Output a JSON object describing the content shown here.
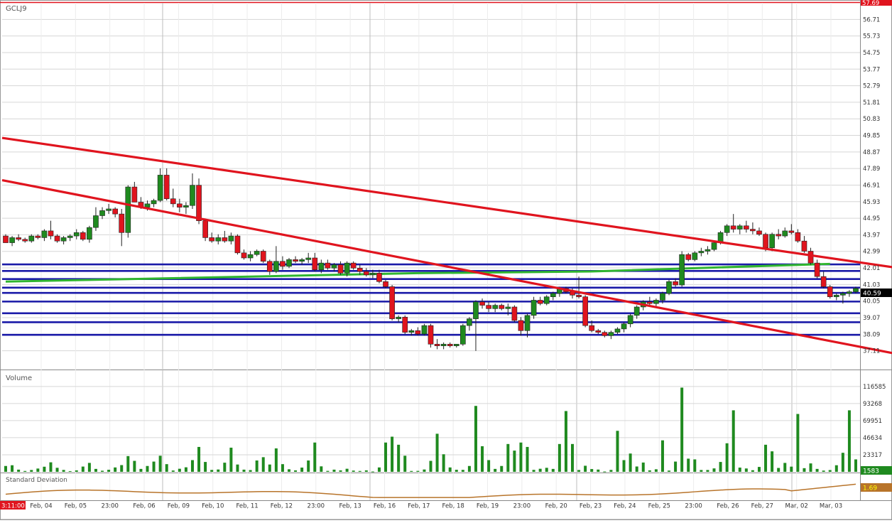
{
  "symbol": "GCLJ9",
  "top_price_label": "57.69",
  "volume_panel_label": "Volume",
  "stddev_panel_label": "Standard Deviation",
  "current_time_label": "3:11:00",
  "colors": {
    "up": "#1f8a1f",
    "down": "#e0141e",
    "trendline": "#e0141e",
    "support": "#1a1aa8",
    "moving_average": "#2fb52f",
    "stddev_line": "#b8742a",
    "grid": "#d6d6d6",
    "axis_highlight": "#ffff00"
  },
  "chart_data": {
    "type": "candlestick",
    "price_axis": {
      "ticks": [
        "56.71",
        "55.73",
        "54.75",
        "53.77",
        "52.79",
        "51.81",
        "50.83",
        "49.85",
        "48.87",
        "47.89",
        "46.91",
        "45.93",
        "44.95",
        "43.97",
        "42.99",
        "42.01",
        "41.03",
        "40.05",
        "39.07",
        "38.09",
        "37.11"
      ],
      "ylim": [
        36.0,
        57.69
      ],
      "last_price": "40.59"
    },
    "x_labels": [
      "Feb, 04",
      "Feb, 05",
      "23:00",
      "Feb, 06",
      "Feb, 09",
      "Feb, 10",
      "Feb, 11",
      "Feb, 12",
      "23:00",
      "Feb, 13",
      "Feb, 16",
      "Feb, 17",
      "Feb, 18",
      "Feb, 19",
      "23:00",
      "Feb, 20",
      "Feb, 23",
      "Feb, 24",
      "Feb, 25",
      "23:00",
      "Feb, 26",
      "Feb, 27",
      "Mar, 02",
      "Mar, 03"
    ],
    "candles": [
      [
        43.9,
        44.0,
        43.5,
        43.5
      ],
      [
        43.5,
        43.9,
        43.3,
        43.8
      ],
      [
        43.8,
        44.0,
        43.6,
        43.7
      ],
      [
        43.7,
        43.8,
        43.5,
        43.6
      ],
      [
        43.6,
        44.0,
        43.5,
        43.9
      ],
      [
        43.9,
        44.0,
        43.7,
        43.8
      ],
      [
        43.8,
        44.3,
        43.6,
        44.2
      ],
      [
        44.2,
        44.8,
        43.7,
        43.9
      ],
      [
        43.9,
        44.0,
        43.5,
        43.6
      ],
      [
        43.6,
        43.9,
        43.4,
        43.8
      ],
      [
        43.8,
        44.0,
        43.6,
        43.9
      ],
      [
        43.9,
        44.3,
        43.7,
        44.1
      ],
      [
        44.1,
        44.2,
        43.6,
        43.7
      ],
      [
        43.7,
        44.5,
        43.5,
        44.4
      ],
      [
        44.4,
        45.6,
        44.2,
        45.1
      ],
      [
        45.1,
        45.6,
        44.9,
        45.4
      ],
      [
        45.4,
        45.8,
        45.2,
        45.5
      ],
      [
        45.5,
        45.6,
        45.0,
        45.2
      ],
      [
        45.2,
        45.5,
        43.3,
        44.1
      ],
      [
        44.1,
        46.9,
        43.8,
        46.8
      ],
      [
        46.8,
        47.1,
        45.9,
        45.9
      ],
      [
        45.9,
        46.2,
        45.5,
        45.6
      ],
      [
        45.6,
        46.0,
        45.4,
        45.8
      ],
      [
        45.8,
        46.1,
        45.6,
        46.0
      ],
      [
        46.0,
        47.9,
        45.9,
        47.5
      ],
      [
        47.5,
        47.9,
        46.0,
        46.1
      ],
      [
        46.1,
        46.7,
        45.6,
        45.8
      ],
      [
        45.8,
        46.1,
        45.3,
        45.6
      ],
      [
        45.6,
        45.9,
        45.2,
        45.7
      ],
      [
        45.7,
        47.6,
        45.5,
        46.9
      ],
      [
        46.9,
        47.3,
        44.6,
        44.8
      ],
      [
        44.8,
        44.9,
        43.6,
        43.8
      ],
      [
        43.8,
        44.1,
        43.5,
        43.6
      ],
      [
        43.6,
        44.0,
        43.4,
        43.8
      ],
      [
        43.8,
        44.2,
        43.5,
        43.6
      ],
      [
        43.6,
        44.1,
        43.4,
        43.9
      ],
      [
        43.9,
        44.0,
        42.8,
        42.9
      ],
      [
        42.9,
        43.1,
        42.5,
        42.6
      ],
      [
        42.6,
        43.0,
        42.4,
        42.8
      ],
      [
        42.8,
        43.1,
        42.7,
        43.0
      ],
      [
        43.0,
        43.1,
        42.3,
        42.4
      ],
      [
        42.4,
        42.5,
        41.6,
        41.8
      ],
      [
        41.8,
        43.3,
        41.7,
        42.4
      ],
      [
        42.4,
        42.7,
        41.9,
        42.1
      ],
      [
        42.1,
        42.6,
        42.0,
        42.5
      ],
      [
        42.5,
        42.7,
        42.3,
        42.4
      ],
      [
        42.4,
        42.6,
        42.2,
        42.5
      ],
      [
        42.5,
        42.9,
        42.3,
        42.6
      ],
      [
        42.6,
        42.9,
        41.8,
        41.9
      ],
      [
        41.9,
        42.5,
        41.7,
        42.3
      ],
      [
        42.3,
        42.5,
        41.9,
        42.0
      ],
      [
        42.0,
        42.3,
        41.8,
        42.2
      ],
      [
        42.2,
        42.4,
        41.6,
        41.7
      ],
      [
        41.7,
        42.4,
        41.5,
        42.3
      ],
      [
        42.3,
        42.4,
        41.9,
        42.0
      ],
      [
        42.0,
        42.2,
        41.6,
        41.8
      ],
      [
        41.8,
        42.0,
        41.5,
        41.6
      ],
      [
        41.6,
        41.9,
        41.4,
        41.7
      ],
      [
        41.7,
        41.9,
        41.1,
        41.2
      ],
      [
        41.2,
        41.3,
        40.8,
        40.9
      ],
      [
        40.9,
        41.0,
        38.9,
        39.0
      ],
      [
        39.0,
        39.2,
        38.8,
        39.1
      ],
      [
        39.1,
        39.2,
        38.1,
        38.2
      ],
      [
        38.2,
        38.4,
        38.0,
        38.3
      ],
      [
        38.3,
        38.5,
        38.0,
        38.1
      ],
      [
        38.1,
        38.7,
        38.0,
        38.6
      ],
      [
        38.6,
        38.7,
        37.3,
        37.5
      ],
      [
        37.5,
        37.8,
        37.2,
        37.4
      ],
      [
        37.4,
        37.6,
        37.2,
        37.5
      ],
      [
        37.5,
        37.6,
        37.3,
        37.4
      ],
      [
        37.4,
        37.5,
        37.3,
        37.5
      ],
      [
        37.5,
        38.7,
        37.4,
        38.6
      ],
      [
        38.6,
        39.1,
        38.3,
        39.0
      ],
      [
        39.0,
        40.1,
        37.1,
        40.0
      ],
      [
        40.0,
        40.2,
        39.6,
        39.8
      ],
      [
        39.8,
        40.0,
        39.4,
        39.6
      ],
      [
        39.6,
        39.9,
        39.4,
        39.8
      ],
      [
        39.8,
        39.9,
        39.5,
        39.6
      ],
      [
        39.6,
        39.9,
        39.2,
        39.7
      ],
      [
        39.7,
        39.8,
        38.8,
        38.9
      ],
      [
        38.9,
        39.1,
        38.0,
        38.3
      ],
      [
        38.3,
        39.3,
        37.9,
        39.2
      ],
      [
        39.2,
        40.3,
        39.0,
        40.1
      ],
      [
        40.1,
        40.3,
        39.8,
        39.9
      ],
      [
        39.9,
        40.4,
        39.8,
        40.3
      ],
      [
        40.3,
        40.6,
        40.1,
        40.5
      ],
      [
        40.5,
        40.9,
        40.3,
        40.8
      ],
      [
        40.8,
        40.9,
        40.5,
        40.6
      ],
      [
        40.6,
        40.8,
        40.2,
        40.4
      ],
      [
        40.4,
        41.5,
        40.2,
        40.3
      ],
      [
        40.3,
        40.4,
        38.5,
        38.6
      ],
      [
        38.6,
        38.9,
        38.2,
        38.3
      ],
      [
        38.3,
        38.4,
        38.1,
        38.2
      ],
      [
        38.2,
        38.3,
        37.9,
        38.0
      ],
      [
        38.0,
        38.3,
        37.8,
        38.2
      ],
      [
        38.2,
        38.5,
        38.1,
        38.4
      ],
      [
        38.4,
        38.8,
        38.2,
        38.7
      ],
      [
        38.7,
        39.3,
        38.5,
        39.2
      ],
      [
        39.2,
        39.8,
        39.0,
        39.7
      ],
      [
        39.7,
        40.1,
        39.5,
        40.0
      ],
      [
        40.0,
        40.3,
        39.8,
        39.9
      ],
      [
        39.9,
        40.2,
        39.7,
        40.1
      ],
      [
        40.1,
        40.6,
        39.9,
        40.5
      ],
      [
        40.5,
        41.3,
        40.4,
        41.2
      ],
      [
        41.2,
        41.4,
        40.9,
        41.0
      ],
      [
        41.0,
        43.0,
        40.9,
        42.8
      ],
      [
        42.8,
        42.9,
        42.4,
        42.5
      ],
      [
        42.5,
        43.0,
        42.4,
        42.9
      ],
      [
        42.9,
        43.2,
        42.7,
        43.0
      ],
      [
        43.0,
        43.3,
        42.8,
        43.1
      ],
      [
        43.1,
        43.6,
        43.0,
        43.5
      ],
      [
        43.5,
        44.2,
        43.4,
        44.1
      ],
      [
        44.1,
        44.6,
        43.9,
        44.5
      ],
      [
        44.5,
        45.2,
        44.1,
        44.3
      ],
      [
        44.3,
        44.6,
        44.0,
        44.5
      ],
      [
        44.5,
        44.8,
        44.1,
        44.3
      ],
      [
        44.3,
        44.7,
        44.0,
        44.2
      ],
      [
        44.2,
        44.4,
        43.9,
        44.0
      ],
      [
        44.0,
        44.1,
        43.0,
        43.2
      ],
      [
        43.2,
        44.1,
        43.0,
        44.0
      ],
      [
        44.0,
        44.3,
        43.7,
        43.9
      ],
      [
        43.9,
        44.4,
        43.8,
        44.2
      ],
      [
        44.2,
        44.6,
        44.0,
        44.1
      ],
      [
        44.1,
        44.3,
        43.5,
        43.6
      ],
      [
        43.6,
        43.9,
        42.9,
        43.0
      ],
      [
        43.0,
        43.2,
        42.2,
        42.3
      ],
      [
        42.3,
        42.5,
        41.4,
        41.5
      ],
      [
        41.5,
        41.8,
        40.8,
        40.9
      ],
      [
        40.9,
        41.0,
        40.2,
        40.3
      ],
      [
        40.3,
        40.5,
        40.1,
        40.4
      ],
      [
        40.4,
        40.6,
        39.9,
        40.5
      ],
      [
        40.5,
        40.7,
        40.3,
        40.6
      ],
      [
        40.6,
        40.9,
        40.5,
        40.8
      ]
    ],
    "volume_axis": {
      "ticks": [
        "116585",
        "93268",
        "69951",
        "46634",
        "23317"
      ],
      "ylim": [
        0,
        130000
      ],
      "last_volume": "1583"
    },
    "volume": [
      8000,
      9000,
      3000,
      1200,
      2500,
      4500,
      7000,
      13000,
      5500,
      2600,
      1000,
      2000,
      7200,
      12200,
      4000,
      1500,
      2800,
      6000,
      9200,
      21500,
      15000,
      4000,
      8000,
      14000,
      22000,
      10500,
      1800,
      4200,
      6200,
      16000,
      34000,
      13500,
      2600,
      3200,
      12500,
      33000,
      10000,
      3000,
      2400,
      15500,
      20000,
      10000,
      32000,
      10500,
      3500,
      2000,
      5800,
      15500,
      40000,
      7500,
      1300,
      3000,
      2000,
      4200,
      1700,
      1200,
      2000,
      500,
      6000,
      40000,
      48000,
      37000,
      22000,
      1200,
      1300,
      3200,
      15000,
      52000,
      24000,
      6000,
      2800,
      2700,
      8000,
      90000,
      35000,
      16000,
      4000,
      8000,
      38000,
      29000,
      40000,
      34000,
      2700,
      4200,
      5500,
      4000,
      38000,
      83000,
      38000,
      2500,
      8300,
      3800,
      3100,
      500,
      2600,
      56000,
      16000,
      25000,
      7300,
      12700,
      2000,
      3500,
      43000,
      1700,
      14000,
      115000,
      18000,
      17000,
      2500,
      2500,
      4700,
      13500,
      39000,
      84000,
      5800,
      4600,
      2200,
      6700,
      37000,
      28000,
      5300,
      12200,
      7100,
      79000,
      5000,
      11500,
      4000,
      1700,
      2400,
      9000,
      26000,
      84000,
      17000,
      2000,
      1600,
      1000,
      1583
    ],
    "stddev_last_label": "1.69",
    "moving_average_points": [
      [
        0,
        41.2
      ],
      [
        64,
        41.7
      ],
      [
        91,
        41.8
      ],
      [
        128,
        42.25
      ]
    ],
    "trendlines": [
      {
        "from": [
          0,
          49.7
        ],
        "to": [
          138,
          42.0
        ]
      },
      {
        "from": [
          0,
          47.2
        ],
        "to": [
          138,
          36.9
        ]
      }
    ],
    "support_levels": [
      42.22,
      41.83,
      41.35,
      40.84,
      40.53,
      40.02,
      39.33,
      38.8,
      38.05
    ]
  }
}
